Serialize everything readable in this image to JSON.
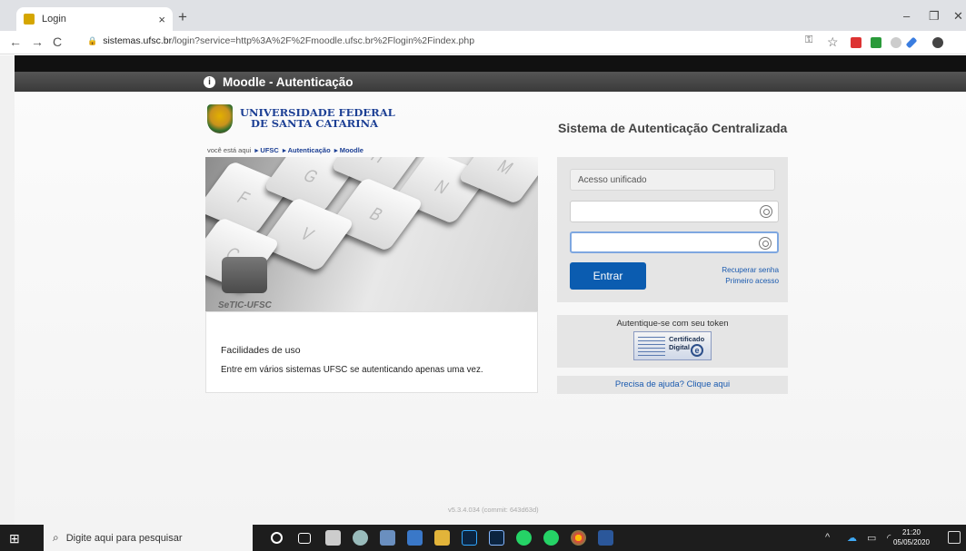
{
  "browser": {
    "tab_title": "Login",
    "tab_close": "×",
    "new_tab": "+",
    "url_host": "sistemas.ufsc.br",
    "url_path": "/login?service=http%3A%2F%2Fmoodle.ufsc.br%2Flogin%2Findex.php",
    "minimize": "–",
    "restore": "❐",
    "close": "✕"
  },
  "header": {
    "title": "Moodle - Autenticação",
    "info_glyph": "i"
  },
  "university": {
    "line1": "UNIVERSIDADE FEDERAL",
    "line2": "DE SANTA CATARINA"
  },
  "breadcrumb": {
    "prefix": "você está aqui",
    "items": [
      "UFSC",
      "Autenticação",
      "Moodle"
    ]
  },
  "keyboard": {
    "keys": [
      "F",
      "G",
      "H",
      "N",
      "M",
      "B",
      "V",
      "C"
    ],
    "brand": "SeTIC-UFSC"
  },
  "features": {
    "heading": "Facilidades de uso",
    "text": "Entre em vários sistemas UFSC se autenticando apenas uma vez."
  },
  "login": {
    "system_title": "Sistema de Autenticação Centralizada",
    "unified_label": "Acesso unificado",
    "username_value": "",
    "password_value": "",
    "submit_label": "Entrar",
    "recover_link": "Recuperar senha",
    "first_access_link": "Primeiro acesso"
  },
  "token": {
    "label": "Autentique-se com seu token",
    "cert_line1": "Certificado",
    "cert_line2": "Digital",
    "cert_e": "e"
  },
  "help": {
    "label": "Precisa de ajuda? Clique aqui"
  },
  "footer": {
    "version": "v5.3.4.034 (commit: 643d63d)"
  },
  "taskbar": {
    "search_placeholder": "Digite aqui para pesquisar",
    "time": "21:20",
    "date": "05/05/2020"
  }
}
